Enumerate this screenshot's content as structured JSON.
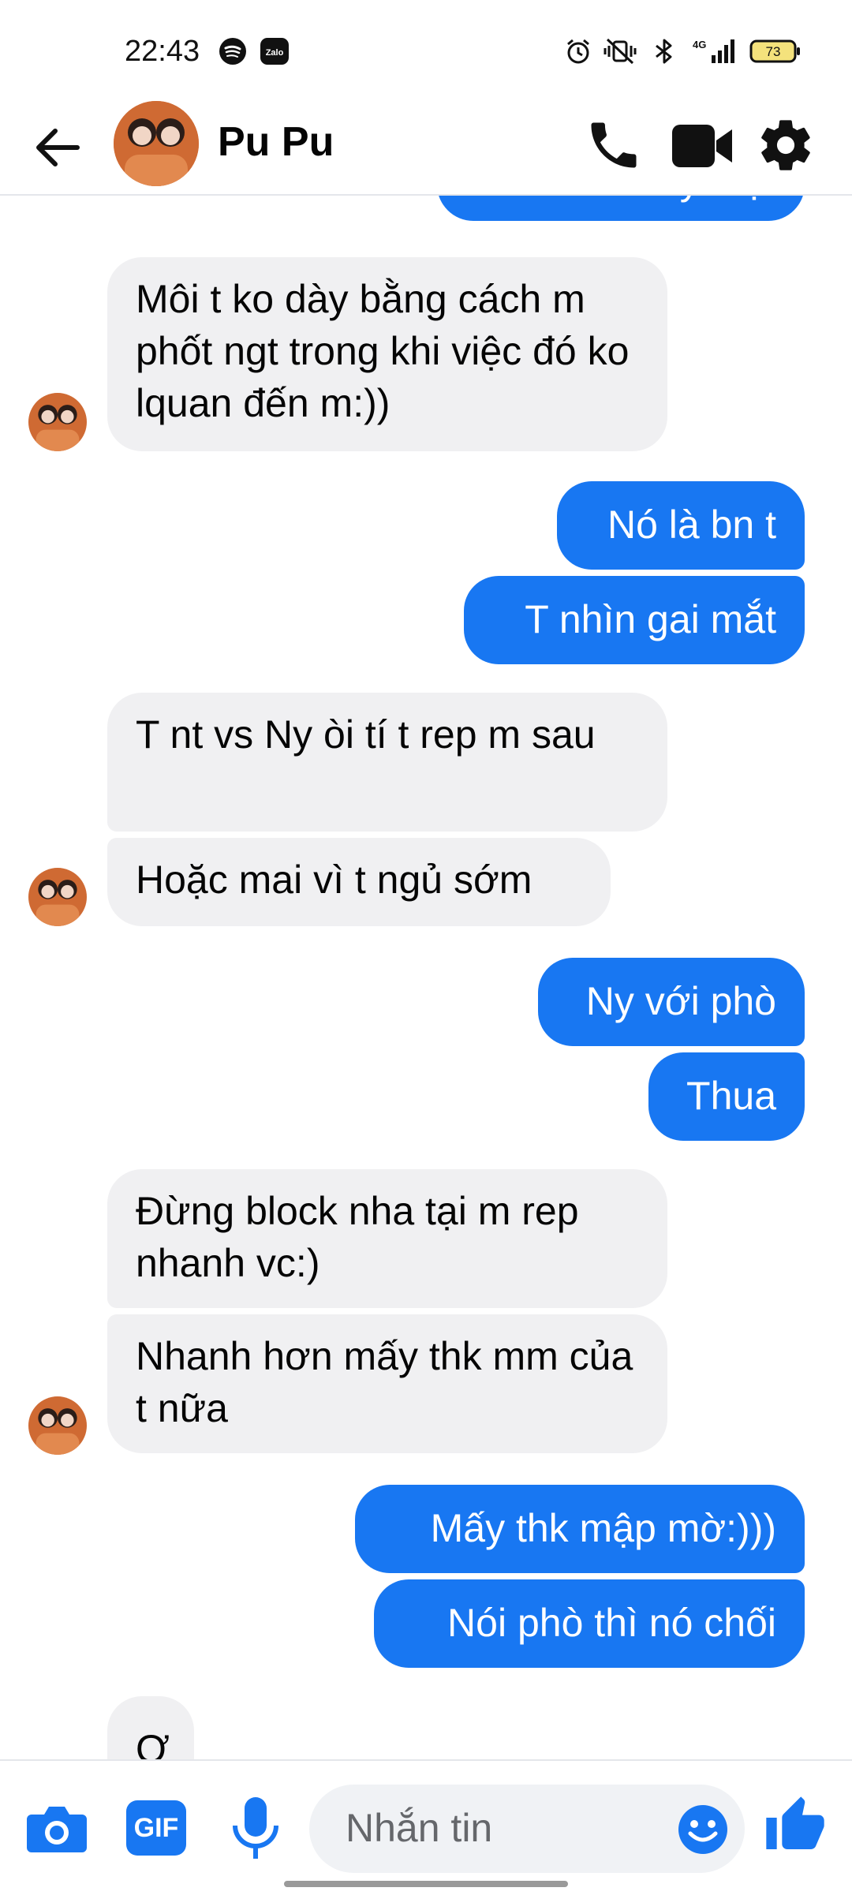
{
  "status_bar": {
    "time": "22:43",
    "battery": "73",
    "network": "4G",
    "icons": [
      "spotify-icon",
      "zalo-icon",
      "alarm-icon",
      "vibrate-icon",
      "bluetooth-icon",
      "signal-icon",
      "battery-icon"
    ],
    "zalo_label": "Zalo"
  },
  "header": {
    "contact_name": "Pu Pu",
    "icons": [
      "back-arrow-icon",
      "phone-icon",
      "video-camera-icon",
      "gear-icon"
    ]
  },
  "messages": [
    {
      "direction": "out",
      "text": "Xinh tù đày mặt",
      "partial": true
    },
    {
      "direction": "in",
      "text": "Môi t ko dày bằng cách m phốt ngt trong khi việc đó ko lquan đến m:))"
    },
    {
      "direction": "out",
      "text": "Nó là bn t"
    },
    {
      "direction": "out",
      "text": "T nhìn gai mắt"
    },
    {
      "direction": "in",
      "text": "T nt vs Ny òi tí t rep m sau"
    },
    {
      "direction": "in",
      "text": "Hoặc mai vì t ngủ sớm"
    },
    {
      "direction": "out",
      "text": "Ny với phò"
    },
    {
      "direction": "out",
      "text": "Thua"
    },
    {
      "direction": "in",
      "text": "Đừng block nha tại m rep nhanh vc:)"
    },
    {
      "direction": "in",
      "text": "Nhanh hơn mấy thk mm của t nữa"
    },
    {
      "direction": "out",
      "text": "Mấy thk mập mờ:)))"
    },
    {
      "direction": "out",
      "text": "Nói phò thì nó chối"
    },
    {
      "direction": "in",
      "text": "Ơ",
      "partial": true
    }
  ],
  "composer": {
    "placeholder": "Nhắn tin",
    "gif_label": "GIF",
    "icons": [
      "camera-icon",
      "gif-icon",
      "microphone-icon",
      "emoji-icon",
      "thumbs-up-icon"
    ]
  },
  "colors": {
    "accent": "#1877f2",
    "incoming_bubble": "#f0f0f2",
    "outgoing_bubble": "#1877f2",
    "avatar_bg": "#d9733a"
  }
}
